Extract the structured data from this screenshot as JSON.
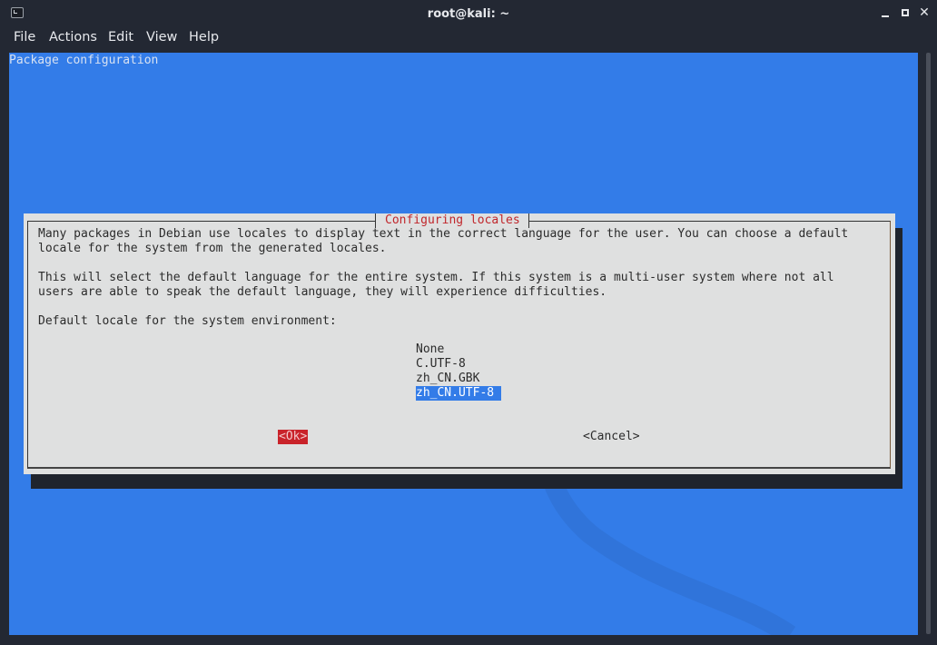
{
  "window": {
    "title": "root@kali: ~",
    "controls": {
      "minimize_icon": "minimize-icon",
      "maximize_icon": "maximize-icon",
      "close_icon": "close-icon",
      "close_glyph": "✕"
    }
  },
  "menubar": {
    "items": [
      "File",
      "Actions",
      "Edit",
      "View",
      "Help"
    ]
  },
  "terminal": {
    "background_title": "Package configuration",
    "colors": {
      "background": "#337ce8",
      "dialog": "#dfe0e0",
      "title_red": "#c0262b",
      "ok_button": "#c9232a",
      "selected": "#337ce8"
    }
  },
  "dialog": {
    "title": "Configuring locales",
    "paragraphs": [
      "Many packages in Debian use locales to display text in the correct language for the user. You can choose a default\nlocale for the system from the generated locales.",
      "This will select the default language for the entire system. If this system is a multi-user system where not all\nusers are able to speak the default language, they will experience difficulties.",
      "Default locale for the system environment:"
    ],
    "options": [
      {
        "label": "None",
        "selected": false
      },
      {
        "label": "C.UTF-8",
        "selected": false
      },
      {
        "label": "zh_CN.GBK",
        "selected": false
      },
      {
        "label": "zh_CN.UTF-8",
        "selected": true
      }
    ],
    "ok_label": "<Ok>",
    "cancel_label": "<Cancel>"
  }
}
